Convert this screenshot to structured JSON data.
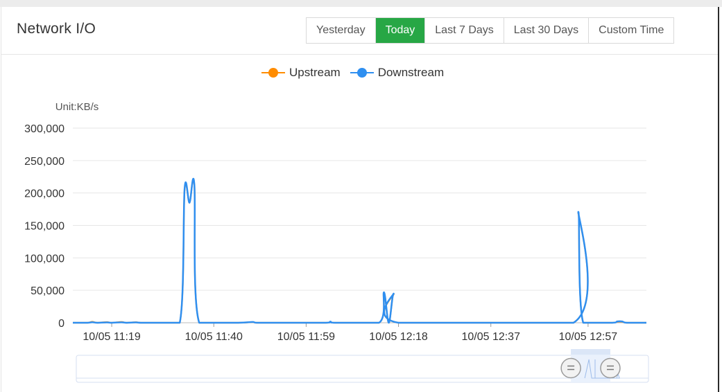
{
  "header": {
    "title": "Network I/O",
    "tabs": [
      {
        "label": "Yesterday",
        "active": false
      },
      {
        "label": "Today",
        "active": true
      },
      {
        "label": "Last 7 Days",
        "active": false
      },
      {
        "label": "Last 30 Days",
        "active": false
      },
      {
        "label": "Custom Time",
        "active": false
      }
    ]
  },
  "colors": {
    "upstream": "#ff8c00",
    "downstream": "#2f8ff0",
    "active_tab": "#27a745",
    "grid": "#e6e6e6"
  },
  "chart_data": {
    "type": "line",
    "unit_label": "Unit:KB/s",
    "ylim": [
      0,
      300000
    ],
    "yticks": [
      "0",
      "50,000",
      "100,000",
      "150,000",
      "200,000",
      "250,000",
      "300,000"
    ],
    "xlim": [
      "11:11",
      "13:09"
    ],
    "xticks": [
      "10/05 11:19",
      "10/05 11:40",
      "10/05 11:59",
      "10/05 12:18",
      "10/05 12:37",
      "10/05 12:57"
    ],
    "grid": true,
    "legend_position": "top-center",
    "series": [
      {
        "name": "Upstream",
        "points": [
          [
            "11:11",
            0
          ],
          [
            "11:14",
            0
          ],
          [
            "11:15",
            1500
          ],
          [
            "11:16",
            0
          ],
          [
            "11:18",
            1000
          ],
          [
            "11:19",
            0
          ],
          [
            "11:21",
            1200
          ],
          [
            "11:22",
            0
          ],
          [
            "11:24",
            800
          ],
          [
            "11:25",
            0
          ],
          [
            "11:28",
            0
          ],
          [
            "11:33",
            0
          ],
          [
            "11:34",
            205000
          ],
          [
            "11:35",
            185000
          ],
          [
            "11:36",
            212000
          ],
          [
            "11:37",
            0
          ],
          [
            "11:45",
            0
          ],
          [
            "11:48",
            1000
          ],
          [
            "11:49",
            0
          ],
          [
            "11:55",
            0
          ],
          [
            "12:03",
            0
          ],
          [
            "12:04",
            1500
          ],
          [
            "12:05",
            0
          ],
          [
            "12:14",
            0
          ],
          [
            "12:15",
            46000
          ],
          [
            "12:16",
            0
          ],
          [
            "12:17",
            44000
          ],
          [
            "12:18",
            0
          ],
          [
            "12:54",
            0
          ],
          [
            "12:55",
            170000
          ],
          [
            "12:56",
            0
          ],
          [
            "13:02",
            0
          ],
          [
            "13:03",
            1500
          ],
          [
            "13:04",
            1500
          ],
          [
            "13:05",
            0
          ],
          [
            "13:09",
            0
          ]
        ]
      },
      {
        "name": "Downstream",
        "points": [
          [
            "11:11",
            0
          ],
          [
            "11:14",
            0
          ],
          [
            "11:15",
            800
          ],
          [
            "11:16",
            0
          ],
          [
            "11:18",
            600
          ],
          [
            "11:19",
            0
          ],
          [
            "11:21",
            700
          ],
          [
            "11:22",
            0
          ],
          [
            "11:24",
            500
          ],
          [
            "11:25",
            0
          ],
          [
            "11:28",
            0
          ],
          [
            "11:33",
            0
          ],
          [
            "11:34",
            207000
          ],
          [
            "11:35",
            185000
          ],
          [
            "11:36",
            213000
          ],
          [
            "11:37",
            0
          ],
          [
            "11:45",
            0
          ],
          [
            "11:48",
            1200
          ],
          [
            "11:49",
            0
          ],
          [
            "11:55",
            0
          ],
          [
            "12:03",
            0
          ],
          [
            "12:04",
            1800
          ],
          [
            "12:05",
            0
          ],
          [
            "12:14",
            0
          ],
          [
            "12:15",
            47000
          ],
          [
            "12:16",
            0
          ],
          [
            "12:17",
            45000
          ],
          [
            "12:18",
            0
          ],
          [
            "12:54",
            0
          ],
          [
            "12:55",
            171000
          ],
          [
            "12:56",
            0
          ],
          [
            "13:02",
            0
          ],
          [
            "13:03",
            2000
          ],
          [
            "13:04",
            2000
          ],
          [
            "13:05",
            0
          ],
          [
            "13:09",
            0
          ]
        ]
      }
    ],
    "zoom_window": {
      "start": "12:53",
      "end": "13:09"
    }
  }
}
